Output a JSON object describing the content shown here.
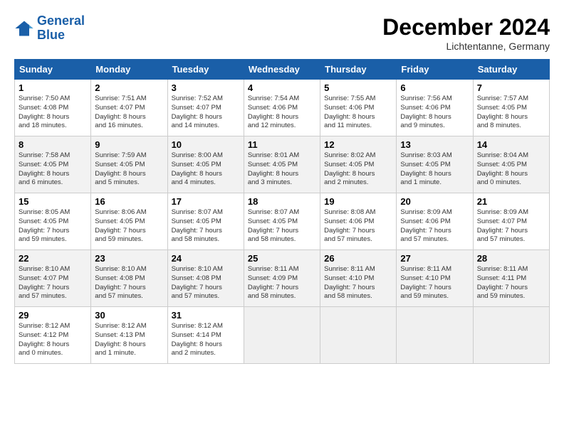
{
  "header": {
    "logo_line1": "General",
    "logo_line2": "Blue",
    "month": "December 2024",
    "location": "Lichtentanne, Germany"
  },
  "weekdays": [
    "Sunday",
    "Monday",
    "Tuesday",
    "Wednesday",
    "Thursday",
    "Friday",
    "Saturday"
  ],
  "weeks": [
    [
      {
        "day": "1",
        "info": "Sunrise: 7:50 AM\nSunset: 4:08 PM\nDaylight: 8 hours\nand 18 minutes."
      },
      {
        "day": "2",
        "info": "Sunrise: 7:51 AM\nSunset: 4:07 PM\nDaylight: 8 hours\nand 16 minutes."
      },
      {
        "day": "3",
        "info": "Sunrise: 7:52 AM\nSunset: 4:07 PM\nDaylight: 8 hours\nand 14 minutes."
      },
      {
        "day": "4",
        "info": "Sunrise: 7:54 AM\nSunset: 4:06 PM\nDaylight: 8 hours\nand 12 minutes."
      },
      {
        "day": "5",
        "info": "Sunrise: 7:55 AM\nSunset: 4:06 PM\nDaylight: 8 hours\nand 11 minutes."
      },
      {
        "day": "6",
        "info": "Sunrise: 7:56 AM\nSunset: 4:06 PM\nDaylight: 8 hours\nand 9 minutes."
      },
      {
        "day": "7",
        "info": "Sunrise: 7:57 AM\nSunset: 4:05 PM\nDaylight: 8 hours\nand 8 minutes."
      }
    ],
    [
      {
        "day": "8",
        "info": "Sunrise: 7:58 AM\nSunset: 4:05 PM\nDaylight: 8 hours\nand 6 minutes."
      },
      {
        "day": "9",
        "info": "Sunrise: 7:59 AM\nSunset: 4:05 PM\nDaylight: 8 hours\nand 5 minutes."
      },
      {
        "day": "10",
        "info": "Sunrise: 8:00 AM\nSunset: 4:05 PM\nDaylight: 8 hours\nand 4 minutes."
      },
      {
        "day": "11",
        "info": "Sunrise: 8:01 AM\nSunset: 4:05 PM\nDaylight: 8 hours\nand 3 minutes."
      },
      {
        "day": "12",
        "info": "Sunrise: 8:02 AM\nSunset: 4:05 PM\nDaylight: 8 hours\nand 2 minutes."
      },
      {
        "day": "13",
        "info": "Sunrise: 8:03 AM\nSunset: 4:05 PM\nDaylight: 8 hours\nand 1 minute."
      },
      {
        "day": "14",
        "info": "Sunrise: 8:04 AM\nSunset: 4:05 PM\nDaylight: 8 hours\nand 0 minutes."
      }
    ],
    [
      {
        "day": "15",
        "info": "Sunrise: 8:05 AM\nSunset: 4:05 PM\nDaylight: 7 hours\nand 59 minutes."
      },
      {
        "day": "16",
        "info": "Sunrise: 8:06 AM\nSunset: 4:05 PM\nDaylight: 7 hours\nand 59 minutes."
      },
      {
        "day": "17",
        "info": "Sunrise: 8:07 AM\nSunset: 4:05 PM\nDaylight: 7 hours\nand 58 minutes."
      },
      {
        "day": "18",
        "info": "Sunrise: 8:07 AM\nSunset: 4:05 PM\nDaylight: 7 hours\nand 58 minutes."
      },
      {
        "day": "19",
        "info": "Sunrise: 8:08 AM\nSunset: 4:06 PM\nDaylight: 7 hours\nand 57 minutes."
      },
      {
        "day": "20",
        "info": "Sunrise: 8:09 AM\nSunset: 4:06 PM\nDaylight: 7 hours\nand 57 minutes."
      },
      {
        "day": "21",
        "info": "Sunrise: 8:09 AM\nSunset: 4:07 PM\nDaylight: 7 hours\nand 57 minutes."
      }
    ],
    [
      {
        "day": "22",
        "info": "Sunrise: 8:10 AM\nSunset: 4:07 PM\nDaylight: 7 hours\nand 57 minutes."
      },
      {
        "day": "23",
        "info": "Sunrise: 8:10 AM\nSunset: 4:08 PM\nDaylight: 7 hours\nand 57 minutes."
      },
      {
        "day": "24",
        "info": "Sunrise: 8:10 AM\nSunset: 4:08 PM\nDaylight: 7 hours\nand 57 minutes."
      },
      {
        "day": "25",
        "info": "Sunrise: 8:11 AM\nSunset: 4:09 PM\nDaylight: 7 hours\nand 58 minutes."
      },
      {
        "day": "26",
        "info": "Sunrise: 8:11 AM\nSunset: 4:10 PM\nDaylight: 7 hours\nand 58 minutes."
      },
      {
        "day": "27",
        "info": "Sunrise: 8:11 AM\nSunset: 4:10 PM\nDaylight: 7 hours\nand 59 minutes."
      },
      {
        "day": "28",
        "info": "Sunrise: 8:11 AM\nSunset: 4:11 PM\nDaylight: 7 hours\nand 59 minutes."
      }
    ],
    [
      {
        "day": "29",
        "info": "Sunrise: 8:12 AM\nSunset: 4:12 PM\nDaylight: 8 hours\nand 0 minutes."
      },
      {
        "day": "30",
        "info": "Sunrise: 8:12 AM\nSunset: 4:13 PM\nDaylight: 8 hours\nand 1 minute."
      },
      {
        "day": "31",
        "info": "Sunrise: 8:12 AM\nSunset: 4:14 PM\nDaylight: 8 hours\nand 2 minutes."
      },
      null,
      null,
      null,
      null
    ]
  ]
}
